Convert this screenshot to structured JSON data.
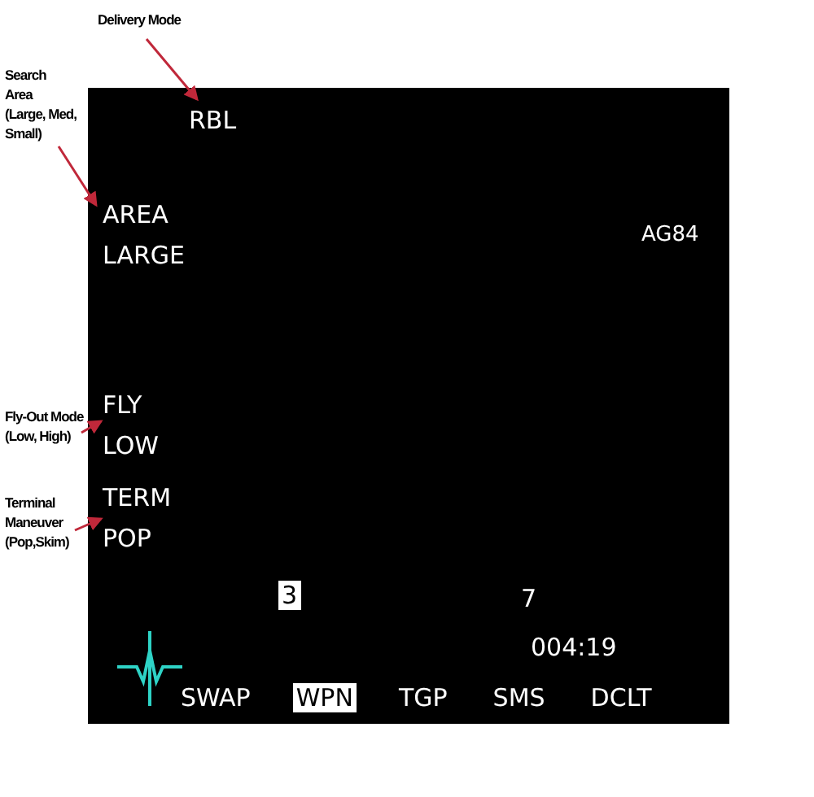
{
  "annotations": [
    {
      "lines": [
        "Delivery Mode"
      ]
    },
    {
      "lines": [
        "Search",
        "Area",
        "(Large, Med,",
        "Small)"
      ]
    },
    {
      "lines": [
        "Fly-Out Mode",
        "(Low, High)"
      ]
    },
    {
      "lines": [
        "Terminal",
        "Maneuver",
        "(Pop,Skim)"
      ]
    }
  ],
  "display": {
    "delivery_mode": "RBL",
    "weapon": "AG84",
    "options": [
      {
        "label": "AREA",
        "value": "LARGE"
      },
      {
        "label": "FLY",
        "value": "LOW"
      },
      {
        "label": "TERM",
        "value": "POP"
      }
    ],
    "counts": [
      {
        "text": "3",
        "selected": true
      },
      {
        "text": "7",
        "selected": false
      }
    ],
    "time": "004:19",
    "buttons": [
      {
        "label": "SWAP",
        "selected": false
      },
      {
        "label": "WPN",
        "selected": true
      },
      {
        "label": "TGP",
        "selected": false
      },
      {
        "label": "SMS",
        "selected": false
      },
      {
        "label": "DCLT",
        "selected": false
      }
    ]
  }
}
